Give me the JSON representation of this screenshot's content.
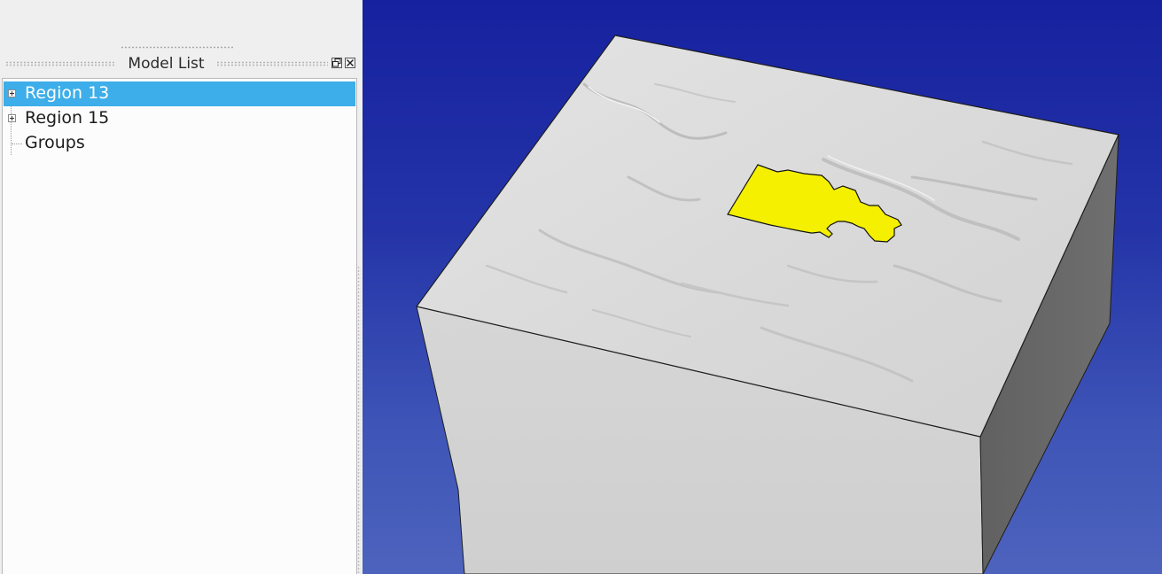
{
  "dock": {
    "title": "Model List",
    "float_icon": "restore-window-icon",
    "close_icon": "close-icon"
  },
  "tree": {
    "items": [
      {
        "label": "Region 13",
        "expandable": true,
        "selected": true
      },
      {
        "label": "Region 15",
        "expandable": true,
        "selected": false
      },
      {
        "label": "Groups",
        "expandable": false,
        "selected": false
      }
    ]
  },
  "viewport": {
    "background_top": "#16219f",
    "background_bottom": "#4d63bd",
    "terrain_top_color": "#dcdcdc",
    "front_face_color": "#d4d4d4",
    "side_face_color": "#6b6b6b",
    "highlight_region_color": "#f4f000"
  },
  "colors": {
    "selection": "#3daee9",
    "panel_bg": "#efefef",
    "tree_bg": "#fcfcfc"
  }
}
